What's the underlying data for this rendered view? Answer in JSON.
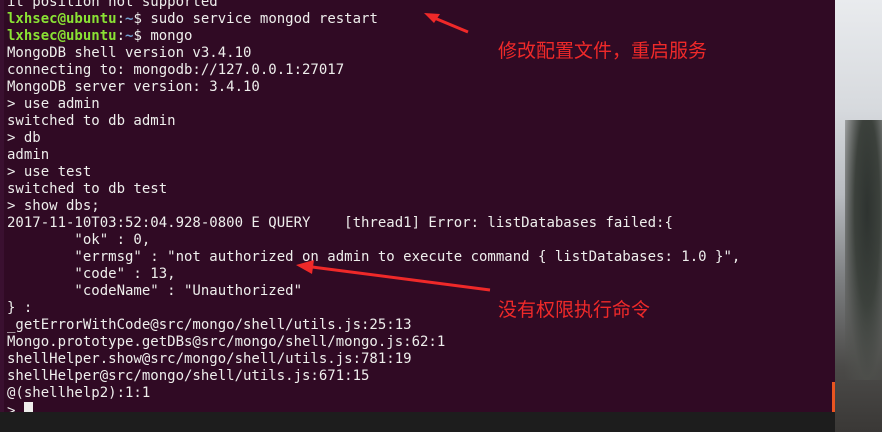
{
  "terminal": {
    "prompt_user": "lxhsec@ubuntu",
    "prompt_sep": ":",
    "prompt_path": "~",
    "prompt_sign": "$ ",
    "lines": {
      "l0": "it position not supported",
      "l1_cmd": "sudo service mongod restart",
      "l2_cmd": "mongo",
      "l3": "MongoDB shell version v3.4.10",
      "l4": "connecting to: mongodb://127.0.0.1:27017",
      "l5": "MongoDB server version: 3.4.10",
      "l6": "> use admin",
      "l7": "switched to db admin",
      "l8": "> db",
      "l9": "admin",
      "l10": "> use test",
      "l11": "switched to db test",
      "l12": "> show dbs;",
      "l13": "2017-11-10T03:52:04.928-0800 E QUERY    [thread1] Error: listDatabases failed:{",
      "l14": "        \"ok\" : 0,",
      "l15": "        \"errmsg\" : \"not authorized on admin to execute command { listDatabases: 1.0 }\",",
      "l16": "        \"code\" : 13,",
      "l17": "        \"codeName\" : \"Unauthorized\"",
      "l18": "} :",
      "l19": "_getErrorWithCode@src/mongo/shell/utils.js:25:13",
      "l20": "Mongo.prototype.getDBs@src/mongo/shell/mongo.js:62:1",
      "l21": "shellHelper.show@src/mongo/shell/utils.js:781:19",
      "l22": "shellHelper@src/mongo/shell/utils.js:671:15",
      "l23": "@(shellhelp2):1:1",
      "l24": "> "
    }
  },
  "annotations": {
    "restart_note": "修改配置文件，重启服务",
    "unauthorized_note": "没有权限执行命令"
  },
  "colors": {
    "terminal_bg": "#300a24",
    "annotation": "#ef2929",
    "prompt_user": "#8ae234",
    "prompt_path": "#729fcf"
  }
}
